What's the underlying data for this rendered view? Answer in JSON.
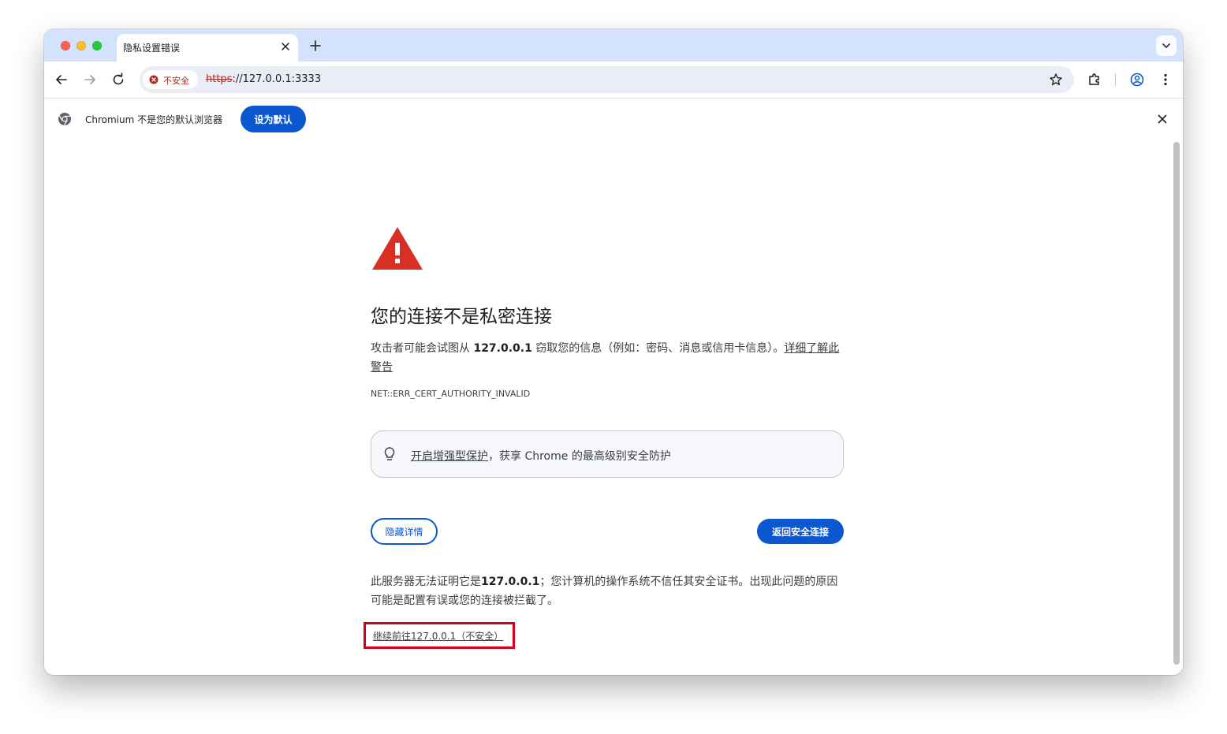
{
  "browser": {
    "tab_title": "隐私设置错误",
    "url_scheme": "https",
    "url_rest": "://127.0.0.1:3333",
    "security_label": "不安全"
  },
  "infobar": {
    "message": "Chromium 不是您的默认浏览器",
    "button_label": "设为默认"
  },
  "page": {
    "heading": "您的连接不是私密连接",
    "desc_prefix": "攻击者可能会试图从 ",
    "desc_host": "127.0.0.1",
    "desc_suffix": " 窃取您的信息（例如：密码、消息或信用卡信息）。",
    "learn_more_link": "详细了解此警告",
    "error_code": "NET::ERR_CERT_AUTHORITY_INVALID",
    "promo_link": "开启增强型保护",
    "promo_text": "，获享 Chrome 的最高级别安全防护",
    "hide_details_button": "隐藏详情",
    "back_button": "返回安全连接",
    "details_prefix": "此服务器无法证明它是",
    "details_host": "127.0.0.1",
    "details_suffix": "；您计算机的操作系统不信任其安全证书。出现此问题的原因可能是配置有误或您的连接被拦截了。",
    "proceed_link": "继续前往127.0.0.1（不安全）"
  },
  "colors": {
    "accent": "#0b57d0",
    "danger": "#b3261e",
    "warning_icon": "#d93025",
    "highlight_box": "#d0021b",
    "tabstrip": "#d3e3fd"
  },
  "icons": [
    "close-icon",
    "plus-icon",
    "chevron-down-icon",
    "back-arrow-icon",
    "forward-arrow-icon",
    "reload-icon",
    "not-secure-icon",
    "star-icon",
    "extensions-icon",
    "profile-icon",
    "menu-dots-icon",
    "chromium-logo-icon",
    "warning-triangle-icon",
    "lightbulb-icon"
  ]
}
